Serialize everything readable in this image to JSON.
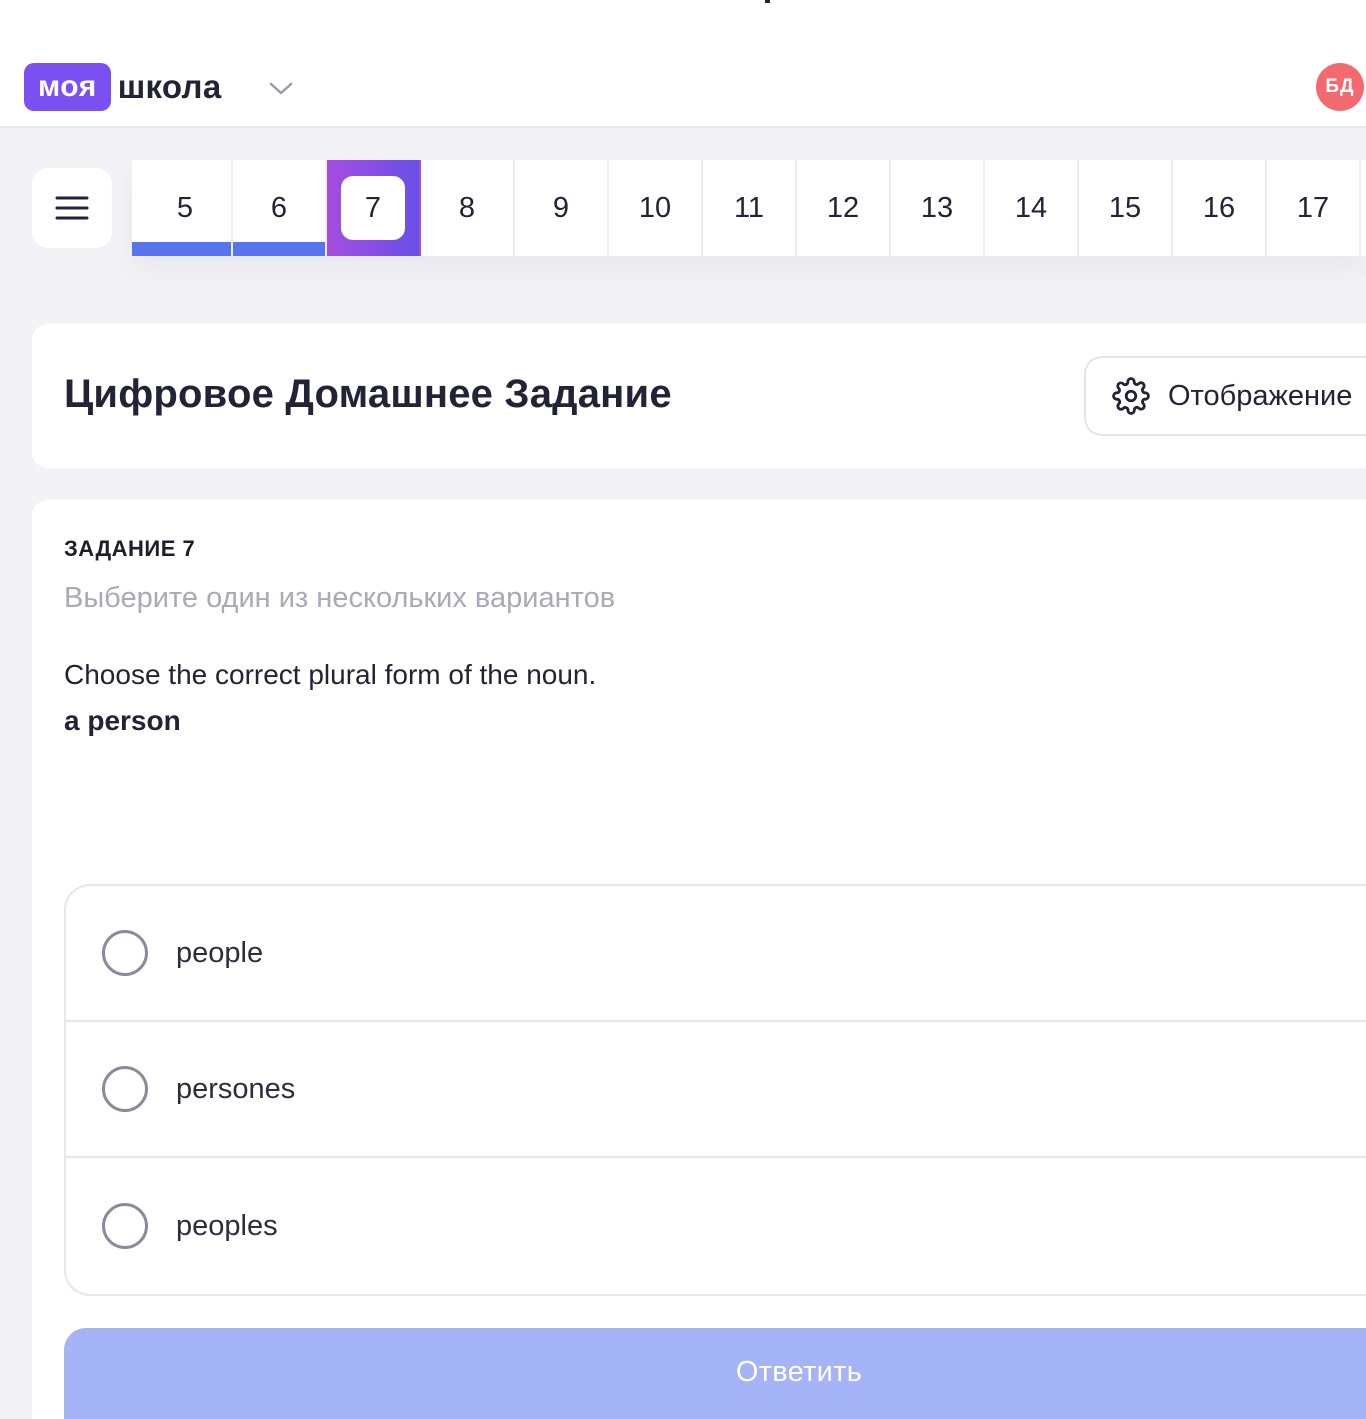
{
  "header": {
    "logo": {
      "badge": "моя",
      "text": "школа"
    },
    "user_initials": "БД"
  },
  "task_nav": {
    "items": [
      {
        "label": "5",
        "state": "done"
      },
      {
        "label": "6",
        "state": "done"
      },
      {
        "label": "7",
        "state": "current"
      },
      {
        "label": "8",
        "state": "pending"
      },
      {
        "label": "9",
        "state": "pending"
      },
      {
        "label": "10",
        "state": "pending"
      },
      {
        "label": "11",
        "state": "pending"
      },
      {
        "label": "12",
        "state": "pending"
      },
      {
        "label": "13",
        "state": "pending"
      },
      {
        "label": "14",
        "state": "pending"
      },
      {
        "label": "15",
        "state": "pending"
      },
      {
        "label": "16",
        "state": "pending"
      },
      {
        "label": "17",
        "state": "pending"
      }
    ]
  },
  "page": {
    "title": "Цифровое Домашнее Задание",
    "display_button": "Отображение"
  },
  "task": {
    "number": "ЗАДАНИЕ 7",
    "hint": "Выберите один из нескольких вариантов",
    "question": "Choose the correct plural form of the noun.",
    "word": "a person",
    "options": [
      {
        "label": "people",
        "selected": false
      },
      {
        "label": "persones",
        "selected": false
      },
      {
        "label": "peoples",
        "selected": false
      }
    ],
    "submit": "Ответить"
  },
  "colors": {
    "brand": "#7b4ff2",
    "progress_done": "#5874ec",
    "avatar": "#f2696e",
    "submit_disabled": "#a5b3f7"
  }
}
